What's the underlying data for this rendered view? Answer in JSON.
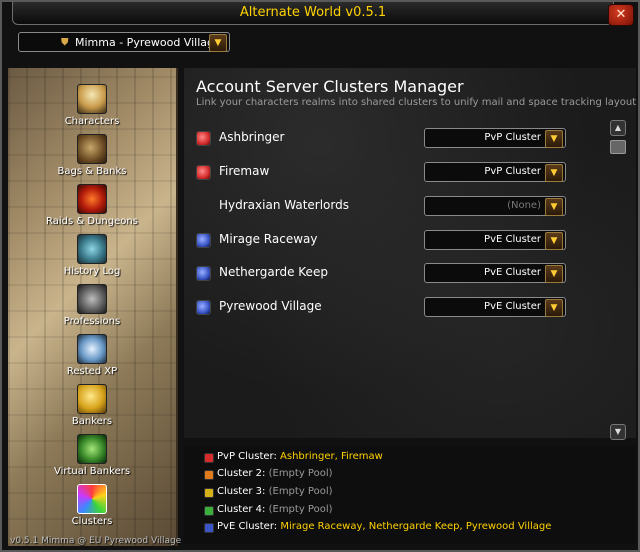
{
  "window": {
    "title": "Alternate World v0.5.1",
    "close_label": "✕"
  },
  "character_dropdown": {
    "value": "Mimma - Pyrewood Village"
  },
  "sidebar": {
    "items": [
      {
        "label": "Characters"
      },
      {
        "label": "Bags & Banks"
      },
      {
        "label": "Raids & Dungeons"
      },
      {
        "label": "History Log"
      },
      {
        "label": "Professions"
      },
      {
        "label": "Rested XP"
      },
      {
        "label": "Bankers"
      },
      {
        "label": "Virtual Bankers"
      },
      {
        "label": "Clusters"
      }
    ]
  },
  "main": {
    "title": "Account Server Clusters Manager",
    "subtitle": "Link your characters realms into shared clusters to unify mail and space tracking layout bucke",
    "realms": [
      {
        "name": "Ashbringer",
        "cluster": "PvP Cluster",
        "icon": "pvp-icon",
        "color": "#d62b2b"
      },
      {
        "name": "Firemaw",
        "cluster": "PvP Cluster",
        "icon": "pvp-icon",
        "color": "#d62b2b"
      },
      {
        "name": "Hydraxian Waterlords",
        "cluster": "(None)",
        "icon": "",
        "color": ""
      },
      {
        "name": "Mirage Raceway",
        "cluster": "PvE Cluster",
        "icon": "pve-icon",
        "color": "#3a55c8"
      },
      {
        "name": "Nethergarde Keep",
        "cluster": "PvE Cluster",
        "icon": "pve-icon",
        "color": "#3a55c8"
      },
      {
        "name": "Pyrewood Village",
        "cluster": "PvE Cluster",
        "icon": "pve-icon",
        "color": "#3a55c8"
      }
    ]
  },
  "legend": {
    "rows": [
      {
        "label": "PvP Cluster:",
        "value": "Ashbringer, Firemaw",
        "color": "#d62b2b"
      },
      {
        "label": "Cluster 2:",
        "value": "(Empty Pool)",
        "color": "#e07a1a"
      },
      {
        "label": "Cluster 3:",
        "value": "(Empty Pool)",
        "color": "#d6b21a"
      },
      {
        "label": "Cluster 4:",
        "value": "(Empty Pool)",
        "color": "#3ab03a"
      },
      {
        "label": "PvE Cluster:",
        "value": "Mirage Raceway, Nethergarde Keep, Pyrewood Village",
        "color": "#3a55c8"
      }
    ]
  },
  "footer": {
    "text": "v0.5.1  Mimma @ EU Pyrewood Village"
  },
  "colors": {
    "accent": "#ffd200",
    "muted": "#9b9b9b"
  }
}
